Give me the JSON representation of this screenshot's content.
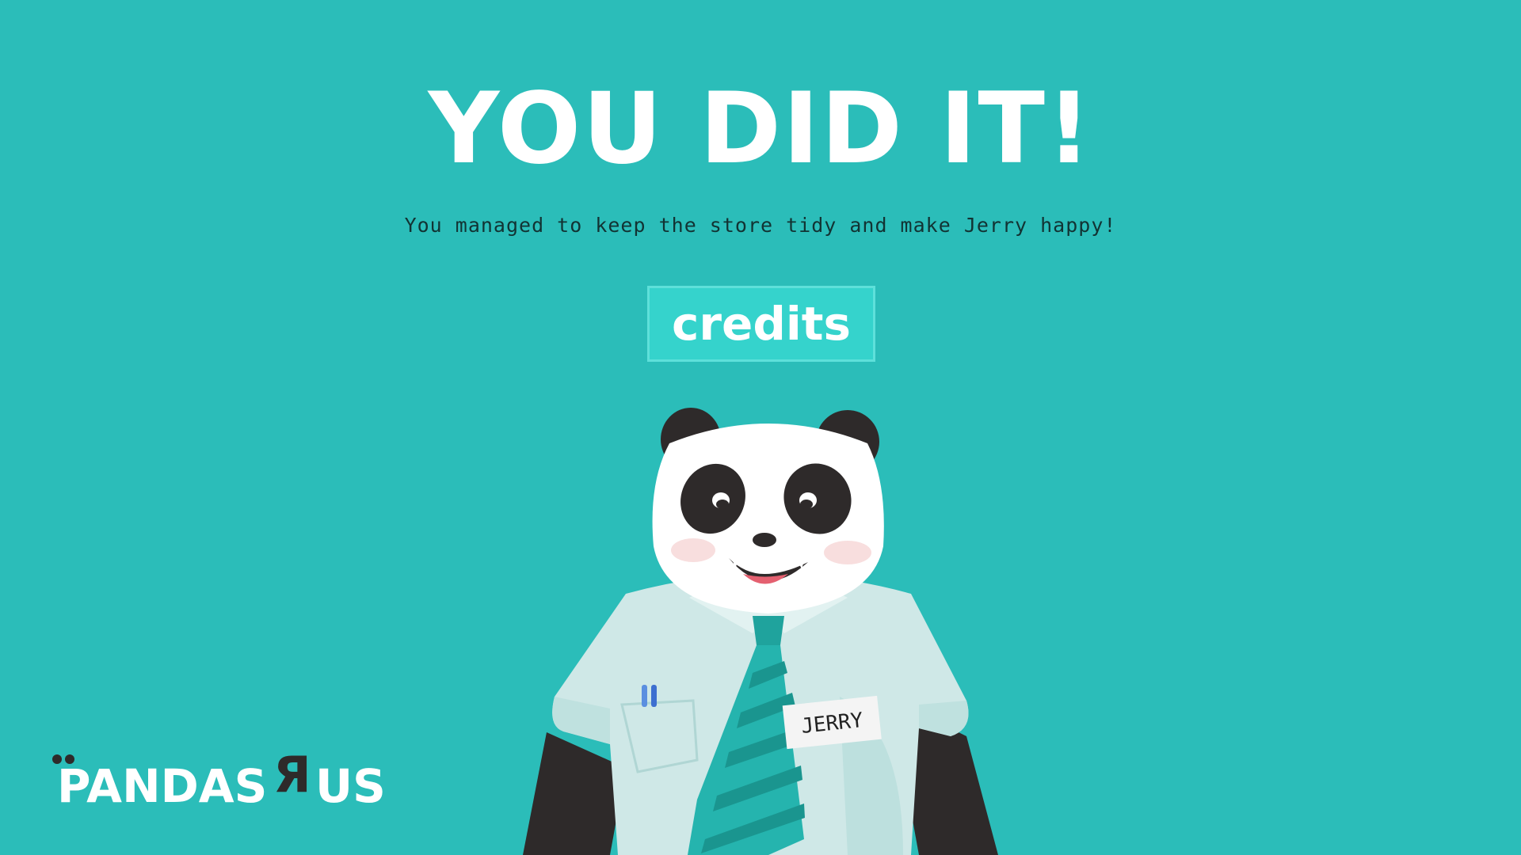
{
  "screen": {
    "headline": "YOU DID IT!",
    "subtitle": "You managed to keep the store tidy and make Jerry happy!",
    "credits_label": "credits"
  },
  "character": {
    "name_tag": "JERRY",
    "icon": "panda-character"
  },
  "logo": {
    "left": "PANDAS",
    "r": "Я",
    "right": "US"
  },
  "colors": {
    "background": "#2bbdb9",
    "button": "#35d3cc",
    "shirt": "#cfe8e7",
    "tie": "#25b4ae",
    "panda_black": "#2e2a2a"
  }
}
